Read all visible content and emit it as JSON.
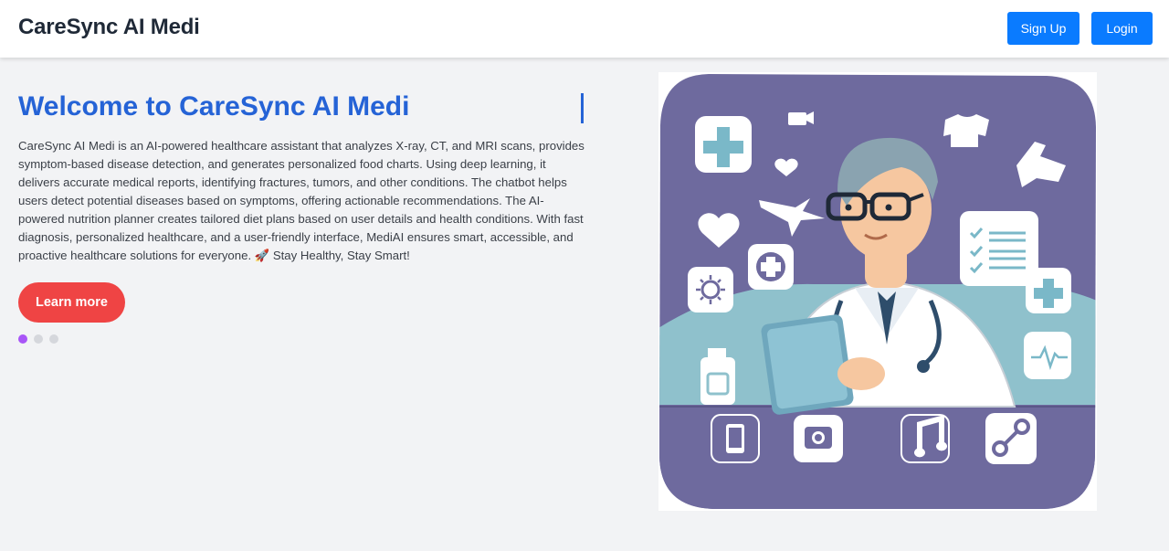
{
  "header": {
    "brand": "CareSync AI Medi",
    "signup_label": "Sign Up",
    "login_label": "Login"
  },
  "hero": {
    "title": "Welcome to CareSync AI Medi",
    "description": "CareSync AI Medi is an AI-powered healthcare assistant that analyzes X-ray, CT, and MRI scans, provides symptom-based disease detection, and generates personalized food charts. Using deep learning, it delivers accurate medical reports, identifying fractures, tumors, and other conditions. The chatbot helps users detect potential diseases based on symptoms, offering actionable recommendations. The AI-powered nutrition planner creates tailored diet plans based on user details and health conditions. With fast diagnosis, personalized healthcare, and a user-friendly interface, MediAI ensures smart, accessible, and proactive healthcare solutions for everyone. 🚀 Stay Healthy, Stay Smart!",
    "cta_label": "Learn more",
    "slides_total": 3,
    "active_slide": 1
  },
  "colors": {
    "brand_blue": "#0a7bff",
    "title_blue": "#2563d6",
    "cta_red": "#ef4444",
    "active_dot": "#a855f7",
    "illustration_purple": "#6e6a9e",
    "illustration_teal": "#8fc1cc"
  },
  "illustration": {
    "subject": "doctor-illustration",
    "icons": [
      "medical-cross-icon",
      "heart-icon",
      "virus-icon",
      "checklist-icon",
      "heartbeat-icon",
      "phone-icon",
      "camera-icon",
      "music-note-icon",
      "link-icon"
    ]
  }
}
